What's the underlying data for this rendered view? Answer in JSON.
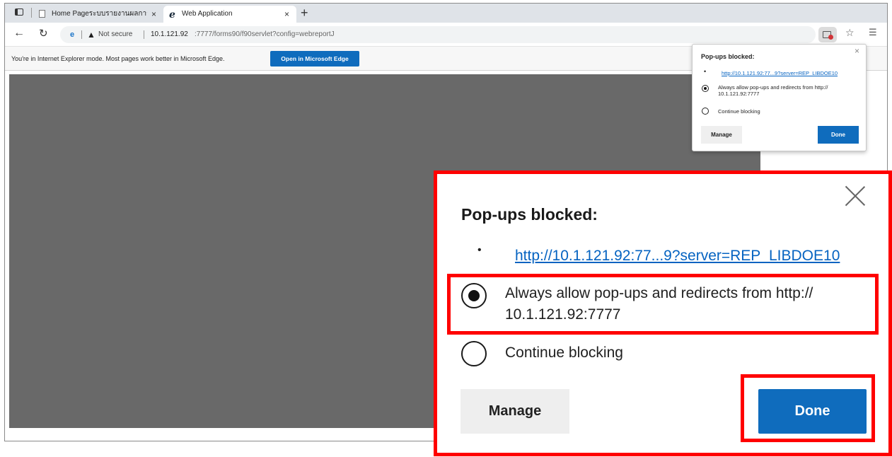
{
  "tabs": [
    {
      "title": "Home Pageระบบรายงานผลการปฏิบั",
      "close": "×"
    },
    {
      "title": "Web Application",
      "close": "×"
    }
  ],
  "new_tab": "+",
  "address_bar": {
    "security_text": "Not secure",
    "url_host": "10.1.121.92",
    "url_path": ":7777/forms90/f90servlet?config=webreportJ"
  },
  "ie_mode_bar": {
    "message": "You're in Internet Explorer mode. Most pages work better in Microsoft Edge.",
    "button_label": "Open in Microsoft Edge"
  },
  "popup": {
    "title": "Pop-ups blocked:",
    "bullet": "•",
    "link": "http://10.1.121.92:77...9?server=REP_LIBDOE10",
    "option_allow": "Always allow pop-ups and redirects from http:// 10.1.121.92:7777",
    "option_allow_line1": "Always allow pop-ups and redirects from http://",
    "option_allow_line2": "10.1.121.92:7777",
    "option_block": "Continue blocking",
    "selected_option": "allow",
    "manage_label": "Manage",
    "done_label": "Done",
    "close": "×"
  },
  "colors": {
    "accent": "#0f6cbd",
    "highlight": "#ff0000",
    "content_background": "#696969"
  },
  "icons": [
    "tab-actions-icon",
    "page-icon",
    "ie-icon",
    "back-icon",
    "refresh-icon",
    "warning-icon",
    "popup-blocked-icon",
    "favorites-icon",
    "collections-icon",
    "close-icon"
  ]
}
